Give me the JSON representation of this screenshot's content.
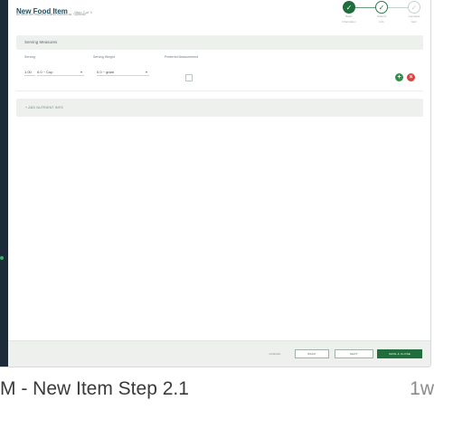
{
  "header": {
    "title": "New Food Item",
    "step_text": "Step 2 of 3",
    "subtitle": "All fields are required unless marked as \"Optional\""
  },
  "stepper": [
    {
      "label_1": "Basic",
      "label_2": "Information",
      "state": "done",
      "glyph": "✓"
    },
    {
      "label_1": "Nutrient",
      "label_2": "Info",
      "state": "current",
      "glyph": "✓"
    },
    {
      "label_1": "Complete",
      "label_2": "Item",
      "state": "todo",
      "glyph": "✓"
    }
  ],
  "serving_section": {
    "title": "Serving Measures",
    "columns": {
      "serving": "Serving",
      "serving_weight": "Serving Weight",
      "preferred": "Preferred Measurement"
    },
    "row": {
      "serving_qty": "1.00",
      "serving_unit": "0.0 ~ Cup",
      "weight": "0.0 ~ gram"
    }
  },
  "add_nutrient_label": "+ ADD NUTRIENT INFO",
  "footer": {
    "cancel": "CANCEL",
    "back": "BACK",
    "next": "NEXT",
    "save": "SAVE & CLOSE"
  },
  "caption": {
    "title": "M - New Item Step 2.1",
    "age": "1w"
  },
  "colors": {
    "accent": "#1f6e3b",
    "add_button": "#2f8f4f",
    "remove_button": "#d64541",
    "rail": "#1c2b37"
  },
  "icons": {
    "add_row": "plus-circle-icon",
    "remove_row": "close-circle-icon"
  }
}
